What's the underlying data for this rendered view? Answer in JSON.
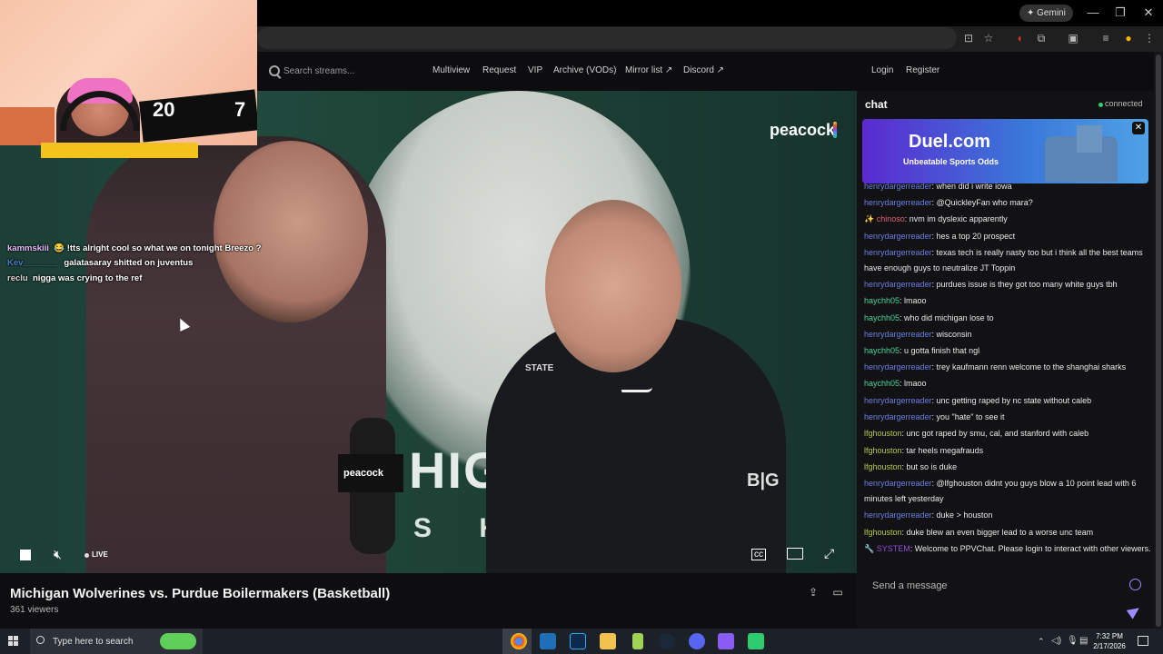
{
  "browser": {
    "gemini_label": "✦ Gemini",
    "window_controls": [
      "—",
      "❐",
      "✕"
    ]
  },
  "site_nav": {
    "search_placeholder": "Search streams...",
    "links": [
      "Multiview",
      "Request",
      "VIP",
      "Archive (VODs)",
      "Mirror list ↗",
      "Discord ↗"
    ],
    "login": "Login",
    "register": "Register"
  },
  "video": {
    "peacock_logo": "peacock",
    "mic_label": "peacock",
    "backdrop_text_1": "HIG",
    "backdrop_text_2": "S K",
    "big_ten_logo": "B|G",
    "jacket_logo": "STATE",
    "overlay_chat": [
      {
        "user": "kammskiii",
        "text": "😂 !tts alright cool so what we on tonight Breezo ?",
        "color": "#e9b8ff"
      },
      {
        "user": "Kev_______",
        "text": "galatasaray shitted on juventus",
        "color": "#4b7ec9"
      },
      {
        "user": "reclu",
        "text": "nigga was crying to the ref",
        "color": "#d9d9d9"
      }
    ],
    "webcam_jersey_numbers": [
      "20",
      "7"
    ],
    "controls": {
      "live_label": "LIVE"
    }
  },
  "stream": {
    "title": "Michigan Wolverines vs. Purdue Boilermakers (Basketball)",
    "viewers": "361 viewers"
  },
  "chat": {
    "heading": "chat",
    "status": "connected",
    "ad": {
      "title": "Duel.com",
      "subtitle": "Unbeatable Sports Odds"
    },
    "messages": [
      {
        "user": "henrydargerreader",
        "text": ": when did i write iowa",
        "color": "#6b7fe0"
      },
      {
        "user": "henrydargerreader",
        "text": ": @QuickleyFan who mara?",
        "color": "#6b7fe0"
      },
      {
        "user": "✨ chinoso",
        "text": ": nvm im dyslexic apparently",
        "color": "#e45f7a"
      },
      {
        "user": "henrydargerreader",
        "text": ": hes a top 20 prospect",
        "color": "#6b7fe0"
      },
      {
        "user": "henrydargerreader",
        "text": ": texas tech is really nasty too but i think all the best teams have enough guys to neutralize JT Toppin",
        "color": "#6b7fe0"
      },
      {
        "user": "henrydargerreader",
        "text": ": purdues issue is they got too many white guys tbh",
        "color": "#6b7fe0"
      },
      {
        "user": "haychh05",
        "text": ": lmaoo",
        "color": "#4ad39a"
      },
      {
        "user": "haychh05",
        "text": ": who did michigan lose to",
        "color": "#4ad39a"
      },
      {
        "user": "henrydargerreader",
        "text": ": wisconsin",
        "color": "#6b7fe0"
      },
      {
        "user": "haychh05",
        "text": ": u gotta finish that ngl",
        "color": "#4ad39a"
      },
      {
        "user": "henrydargerreader",
        "text": ": trey kaufmann renn welcome to the shanghai sharks",
        "color": "#6b7fe0"
      },
      {
        "user": "haychh05",
        "text": ": lmaoo",
        "color": "#4ad39a"
      },
      {
        "user": "henrydargerreader",
        "text": ": unc getting raped by nc state without caleb",
        "color": "#6b7fe0"
      },
      {
        "user": "henrydargerreader",
        "text": ": you \"hate\" to see it",
        "color": "#6b7fe0"
      },
      {
        "user": "lfghouston",
        "text": ": unc got raped by smu, cal, and stanford with caleb",
        "color": "#b7c94a"
      },
      {
        "user": "lfghouston",
        "text": ": tar heels megafrauds",
        "color": "#b7c94a"
      },
      {
        "user": "lfghouston",
        "text": ": but so is duke",
        "color": "#b7c94a"
      },
      {
        "user": "henrydargerreader",
        "text": ": @lfghouston didnt you guys blow a 10 point lead with 6 minutes left yesterday",
        "color": "#6b7fe0"
      },
      {
        "user": "henrydargerreader",
        "text": ": duke > houston",
        "color": "#6b7fe0"
      },
      {
        "user": "lfghouston",
        "text": ": duke blew an even bigger lead to a worse unc team",
        "color": "#b7c94a"
      },
      {
        "user": "🔧 SYSTEM",
        "text": ": Welcome to PPVChat. Please login to interact with other viewers.",
        "color": "#8a4fd8"
      }
    ],
    "input_placeholder": "Send a message"
  },
  "taskbar": {
    "search_placeholder": "Type here to search",
    "time": "7:32 PM",
    "date": "2/17/2026"
  }
}
